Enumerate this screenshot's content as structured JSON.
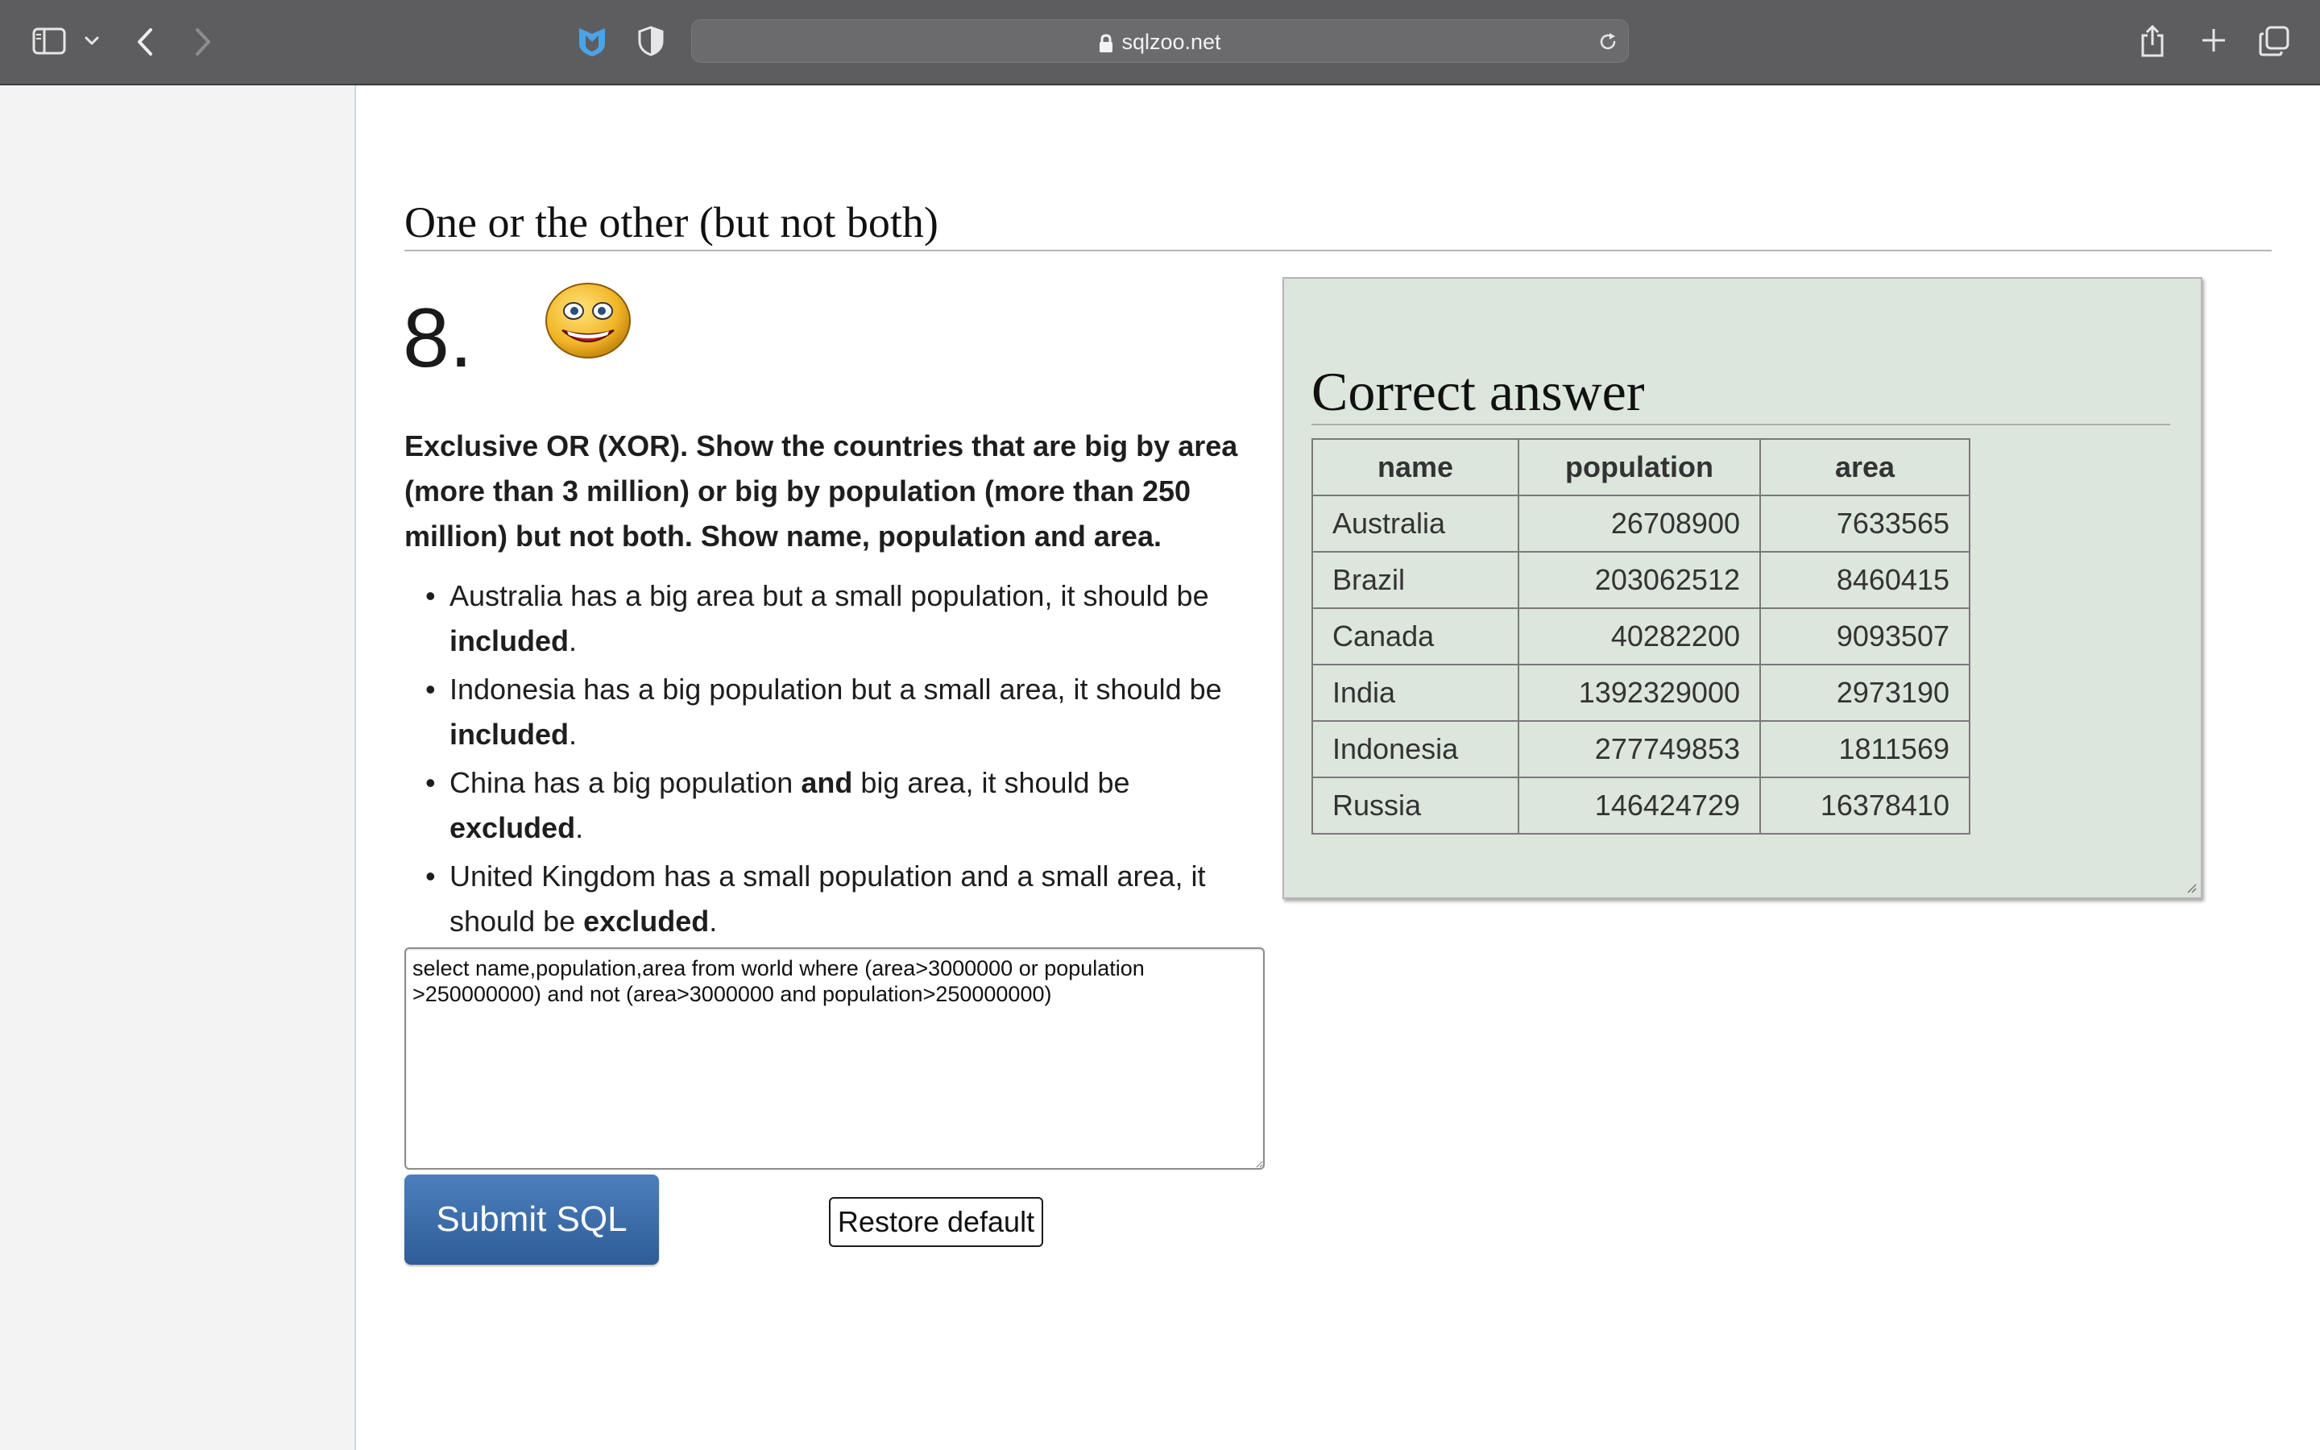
{
  "browser": {
    "url": "sqlzoo.net",
    "icons": [
      "sidebar-icon",
      "chevron-down-icon",
      "back-icon",
      "forward-icon",
      "shield-extension-icon",
      "privacy-shield-icon",
      "lock-icon",
      "reload-icon",
      "share-icon",
      "new-tab-icon",
      "tab-overview-icon"
    ]
  },
  "page": {
    "section_heading": "One or the other (but not both)",
    "question_number": "8.",
    "emoji_icon": "grinning-face-icon",
    "question_text": "Exclusive OR (XOR). Show the countries that are big by area (more than 3 million) or big by population (more than 250 million) but not both. Show name, population and area.",
    "bullets": [
      {
        "text": "Australia has a big area but a small population, it should be ",
        "bold": "included",
        "end": "."
      },
      {
        "text": "Indonesia has a big population but a small area, it should be ",
        "bold": "included",
        "end": "."
      },
      {
        "pre": "China has a big population ",
        "mid_bold": "and",
        "text": " big area, it should be ",
        "bold": "excluded",
        "end": "."
      },
      {
        "text": "United Kingdom has a small population and a small area, it should be ",
        "bold": "excluded",
        "end": "."
      }
    ],
    "sql": "select name,population,area from world where (area>3000000 or population >250000000) and not (area>3000000 and population>250000000)",
    "submit_label": "Submit SQL",
    "restore_label": "Restore default"
  },
  "answer": {
    "title": "Correct answer",
    "columns": [
      "name",
      "population",
      "area"
    ],
    "rows": [
      [
        "Australia",
        "26708900",
        "7633565"
      ],
      [
        "Brazil",
        "203062512",
        "8460415"
      ],
      [
        "Canada",
        "40282200",
        "9093507"
      ],
      [
        "India",
        "1392329000",
        "2973190"
      ],
      [
        "Indonesia",
        "277749853",
        "1811569"
      ],
      [
        "Russia",
        "146424729",
        "16378410"
      ]
    ]
  },
  "colors": {
    "toolbar": "#5d5d5f",
    "panel_bg": "#dce6dc",
    "submit_bg": "#2e5d98",
    "extension_accent": "#4aa3e6"
  }
}
